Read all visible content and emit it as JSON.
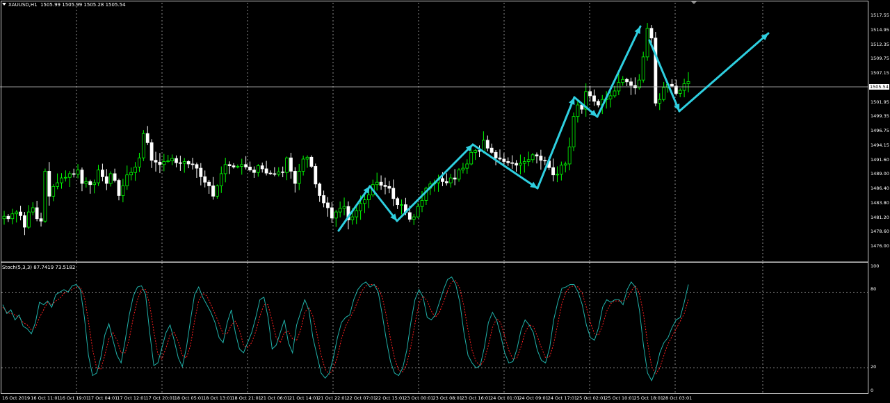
{
  "header": {
    "symbol": "XAUUSD,H1",
    "ohlc": "1505.99 1505.99 1505.28 1505.54"
  },
  "indicator": {
    "label": "Stoch(5,3,3) 87.7419 73.5182",
    "levels": [
      "100",
      "80",
      "20",
      "0"
    ]
  },
  "price_axis": {
    "labels": [
      "1517.55",
      "1514.95",
      "1512.35",
      "1509.75",
      "1507.15",
      "1504.55",
      "1501.95",
      "1499.35",
      "1496.75",
      "1494.15",
      "1491.60",
      "1489.00",
      "1486.40",
      "1483.80",
      "1481.20",
      "1478.60",
      "1476.00"
    ],
    "current": "1505.54"
  },
  "time_axis": {
    "labels": [
      "16 Oct 2019",
      "16 Oct 11:01",
      "16 Oct 19:01",
      "17 Oct 04:01",
      "17 Oct 12:01",
      "17 Oct 20:01",
      "18 Oct 05:01",
      "18 Oct 13:01",
      "18 Oct 21:01",
      "21 Oct 06:01",
      "21 Oct 14:01",
      "21 Oct 22:01",
      "22 Oct 07:01",
      "22 Oct 15:01",
      "23 Oct 00:01",
      "23 Oct 08:01",
      "23 Oct 16:01",
      "24 Oct 01:01",
      "24 Oct 09:01",
      "24 Oct 17:01",
      "25 Oct 02:01",
      "25 Oct 10:01",
      "25 Oct 18:01",
      "28 Oct 03:01"
    ]
  },
  "colors": {
    "background": "#000000",
    "bull": "#00ff00",
    "bear": "#ffffff",
    "arrow": "#2ecfe0",
    "stoch_main": "#20b2aa",
    "stoch_signal": "#ff2020",
    "grid": "#c8c8c8"
  },
  "chart_data": {
    "type": "candlestick",
    "ylim": [
      1476.0,
      1518.5
    ],
    "closes": [
      1483.4,
      1483.0,
      1483.8,
      1484.1,
      1483.5,
      1481.6,
      1484.1,
      1484.8,
      1483.0,
      1482.6,
      1490.8,
      1486.7,
      1488.3,
      1488.9,
      1489.7,
      1489.8,
      1490.4,
      1490.3,
      1491.0,
      1488.8,
      1489.1,
      1488.6,
      1488.9,
      1491.0,
      1489.9,
      1488.8,
      1490.4,
      1489.3,
      1486.8,
      1488.4,
      1490.2,
      1490.6,
      1491.5,
      1493.0,
      1497.0,
      1495.5,
      1492.6,
      1492.3,
      1491.9,
      1492.4,
      1492.5,
      1492.9,
      1492.2,
      1492.1,
      1492.4,
      1492.0,
      1491.9,
      1491.3,
      1489.9,
      1489.0,
      1488.4,
      1486.7,
      1488.4,
      1490.4,
      1491.9,
      1491.7,
      1491.5,
      1491.6,
      1491.9,
      1491.5,
      1491.0,
      1490.6,
      1491.7,
      1491.2,
      1490.5,
      1490.4,
      1490.3,
      1490.7,
      1490.6,
      1493.0,
      1490.8,
      1488.8,
      1490.8,
      1492.8,
      1493.1,
      1491.6,
      1488.7,
      1486.8,
      1485.6,
      1484.8,
      1483.1,
      1484.1,
      1484.7,
      1485.0,
      1482.8,
      1483.3,
      1484.3,
      1485.5,
      1486.1,
      1486.9,
      1488.6,
      1489.0,
      1488.5,
      1488.3,
      1488.0,
      1486.3,
      1485.3,
      1485.3,
      1484.0,
      1482.9,
      1483.3,
      1485.0,
      1486.0,
      1488.0,
      1488.7,
      1488.9,
      1489.6,
      1489.1,
      1488.9,
      1489.7,
      1489.5,
      1491.0,
      1491.3,
      1492.0,
      1493.9,
      1494.2,
      1494.1,
      1495.9,
      1494.6,
      1493.9,
      1493.0,
      1492.8,
      1492.4,
      1492.2,
      1492.1,
      1491.8,
      1492.1,
      1492.4,
      1492.7,
      1493.5,
      1493.3,
      1492.6,
      1492.5,
      1491.4,
      1490.2,
      1490.3,
      1491.8,
      1492.0,
      1494.8,
      1499.8,
      1501.7,
      1501.0,
      1503.9,
      1503.2,
      1502.3,
      1501.7,
      1502.6,
      1502.7,
      1503.2,
      1504.0,
      1505.4,
      1505.9,
      1505.5,
      1504.9,
      1504.5,
      1505.8,
      1509.6,
      1514.3,
      1512.7,
      1502.0,
      1502.6,
      1504.6,
      1505.1,
      1504.8,
      1503.6,
      1504.1,
      1505.2,
      1505.54
    ],
    "stoch_main": [
      70,
      63,
      66,
      58,
      62,
      53,
      51,
      47,
      56,
      72,
      70,
      73,
      68,
      78,
      80,
      82,
      80,
      85,
      86,
      82,
      60,
      30,
      14,
      16,
      28,
      46,
      55,
      42,
      30,
      24,
      42,
      62,
      77,
      84,
      85,
      78,
      48,
      22,
      24,
      36,
      48,
      54,
      42,
      28,
      21,
      36,
      58,
      78,
      84,
      76,
      70,
      64,
      56,
      44,
      40,
      56,
      66,
      48,
      35,
      32,
      40,
      48,
      60,
      74,
      76,
      60,
      35,
      38,
      48,
      58,
      40,
      32,
      54,
      64,
      74,
      66,
      44,
      30,
      16,
      12,
      16,
      28,
      44,
      56,
      60,
      62,
      74,
      82,
      86,
      88,
      84,
      86,
      80,
      62,
      42,
      25,
      16,
      14,
      20,
      34,
      56,
      74,
      82,
      76,
      60,
      58,
      62,
      72,
      82,
      90,
      92,
      86,
      72,
      48,
      30,
      24,
      20,
      22,
      36,
      56,
      64,
      58,
      46,
      32,
      24,
      25,
      35,
      50,
      58,
      54,
      48,
      34,
      26,
      24,
      36,
      58,
      72,
      83,
      84,
      86,
      86,
      80,
      70,
      54,
      44,
      42,
      52,
      68,
      74,
      72,
      74,
      74,
      70,
      82,
      88,
      84,
      66,
      38,
      16,
      10,
      18,
      32,
      40,
      44,
      52,
      58,
      60,
      72,
      86
    ],
    "stoch_signal": [
      68,
      64,
      63,
      62,
      60,
      56,
      54,
      50,
      52,
      60,
      66,
      72,
      70,
      73,
      75,
      79,
      81,
      82,
      84,
      84,
      76,
      57,
      35,
      20,
      19,
      30,
      43,
      48,
      42,
      32,
      32,
      43,
      60,
      74,
      82,
      82,
      70,
      49,
      31,
      27,
      36,
      46,
      48,
      41,
      30,
      28,
      38,
      57,
      73,
      79,
      77,
      70,
      63,
      55,
      47,
      47,
      54,
      57,
      50,
      38,
      36,
      40,
      49,
      61,
      70,
      70,
      57,
      44,
      40,
      48,
      49,
      43,
      42,
      50,
      64,
      68,
      61,
      47,
      30,
      19,
      15,
      19,
      29,
      43,
      53,
      59,
      65,
      73,
      81,
      85,
      86,
      86,
      83,
      76,
      61,
      43,
      28,
      18,
      17,
      23,
      37,
      55,
      71,
      77,
      73,
      65,
      60,
      64,
      72,
      81,
      88,
      89,
      83,
      69,
      50,
      34,
      25,
      22,
      26,
      38,
      52,
      59,
      56,
      45,
      34,
      27,
      28,
      37,
      48,
      54,
      53,
      45,
      36,
      28,
      29,
      39,
      55,
      71,
      80,
      84,
      85,
      84,
      79,
      68,
      56,
      47,
      46,
      54,
      65,
      71,
      73,
      73,
      73,
      75,
      81,
      85,
      79,
      63,
      40,
      21,
      15,
      20,
      30,
      39,
      45,
      51,
      57,
      63,
      74
    ],
    "stoch_ylim": [
      0,
      100
    ]
  }
}
